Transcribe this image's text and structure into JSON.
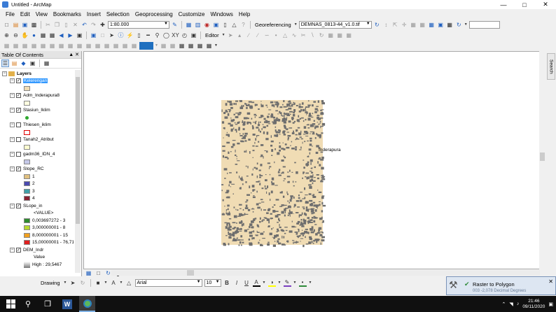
{
  "window": {
    "title": "Untitled - ArcMap"
  },
  "menu": [
    "File",
    "Edit",
    "View",
    "Bookmarks",
    "Insert",
    "Selection",
    "Geoprocessing",
    "Customize",
    "Windows",
    "Help"
  ],
  "toolbar": {
    "scale": "1:80.000",
    "georef_label": "Georeferencing",
    "georef_layer": "DEMNAS_0813-44_v1.0.tif",
    "editor_label": "Editor"
  },
  "toc": {
    "title": "Table Of Contents",
    "root": "Layers",
    "layers": [
      {
        "name": "Kelerengan",
        "checked": true,
        "selected": true,
        "legend": [
          {
            "label": "",
            "color": "#f0dcb4"
          }
        ]
      },
      {
        "name": "Adm_Inderapura8",
        "checked": true,
        "legend": [
          {
            "label": "",
            "color": "#ffffe0"
          }
        ]
      },
      {
        "name": "Stasiun_Iklim",
        "checked": true,
        "legend": [
          {
            "label": "",
            "color": "#2ea82e",
            "dot": true
          }
        ]
      },
      {
        "name": "Thiesen_iklim",
        "checked": false,
        "legend": [
          {
            "label": "",
            "color": "#ffffff",
            "border": "#d00"
          }
        ]
      },
      {
        "name": "Tanah2_Atribut",
        "checked": false,
        "legend": [
          {
            "label": "",
            "color": "#ffffd0"
          }
        ]
      },
      {
        "name": "gadm36_IDN_4",
        "checked": false,
        "legend": [
          {
            "label": "",
            "color": "#c5c8e8"
          }
        ]
      },
      {
        "name": "Slope_RC",
        "checked": true,
        "legend": [
          {
            "label": "1",
            "color": "#e0c080"
          },
          {
            "label": "2",
            "color": "#4a4ab0"
          },
          {
            "label": "3",
            "color": "#40a0a8"
          },
          {
            "label": "4",
            "color": "#8a2030"
          }
        ]
      },
      {
        "name": "SLope_in",
        "checked": true,
        "legend": [
          {
            "label": "<VALUE>",
            "color": "",
            "header": true
          },
          {
            "label": "0,003697272 - 3",
            "color": "#2e8b2e"
          },
          {
            "label": "3,000000001 - 8",
            "color": "#b8d830"
          },
          {
            "label": "8,000000001 - 15",
            "color": "#f0a020"
          },
          {
            "label": "15,00000001 - 76,71",
            "color": "#e02020"
          }
        ]
      },
      {
        "name": "DEM_Indr",
        "checked": true,
        "legend": [
          {
            "label": "Value",
            "color": "",
            "header": true
          },
          {
            "label": "High : 29,5467",
            "color": "#777777",
            "gradient": true
          }
        ]
      }
    ]
  },
  "map": {
    "label": "Inderapura"
  },
  "side_tab": "Search",
  "drawbar": {
    "drawing_label": "Drawing",
    "font": "Arial",
    "font_size": "10",
    "bold": "B",
    "italic": "I",
    "underline": "U"
  },
  "notification": {
    "title": "Raster to Polygon",
    "subtitle": "003 -2,078 Decimal Degrees"
  },
  "clock": {
    "time": "21:46",
    "date": "09/11/2020"
  },
  "colors": {
    "map_land": "#f0dcb4",
    "map_dark": "#6e6e6e",
    "accent": "#3399ff"
  }
}
